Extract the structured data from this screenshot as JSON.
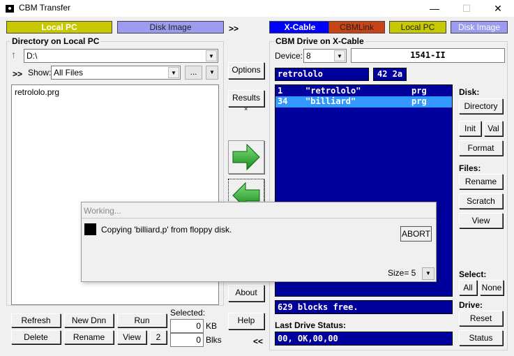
{
  "window": {
    "title": "CBM Transfer",
    "minimize": "—",
    "maximize": "☐",
    "close": "✕"
  },
  "modes_left": {
    "local_pc": "Local PC",
    "disk_image": "Disk Image",
    "forward": ">>"
  },
  "modes_right": {
    "xcable": "X-Cable",
    "cbmlink": "CBMLink",
    "local_pc": "Local PC",
    "disk_image": "Disk Image"
  },
  "local": {
    "group_title": "Directory on Local PC",
    "path": "D:\\",
    "show_label": "Show:",
    "filter": "All Files",
    "expand": ">>",
    "browse": "...",
    "files": [
      "retrololo.prg"
    ]
  },
  "middle": {
    "options": "Options",
    "results": "Results",
    "results_mark": "×",
    "about": "About",
    "help": "Help",
    "back": "<<"
  },
  "bottom_left": {
    "refresh": "Refresh",
    "new_dir": "New Dnn",
    "run": "Run",
    "delete": "Delete",
    "rename": "Rename",
    "view": "View",
    "two": "2",
    "selected_label": "Selected:",
    "kb_value": "0",
    "kb_unit": "KB",
    "blks_value": "0",
    "blks_unit": "Blks"
  },
  "drive": {
    "group_title": "CBM Drive on X-Cable",
    "device_label": "Device:",
    "device": "8",
    "model": "1541-II",
    "disk_name": "retrololo",
    "disk_id": "42 2a",
    "files": [
      {
        "blocks": "1",
        "name": "\"retrololo\"",
        "type": "prg",
        "selected": false
      },
      {
        "blocks": "34",
        "name": "\"billiard\"",
        "type": "prg",
        "selected": true
      }
    ],
    "blocks_free": "629 blocks free.",
    "status_label": "Last Drive Status:",
    "status": "00, OK,00,00"
  },
  "right_panel": {
    "disk_label": "Disk:",
    "directory": "Directory",
    "init": "Init",
    "val": "Val",
    "format": "Format",
    "files_label": "Files:",
    "rename": "Rename",
    "scratch": "Scratch",
    "view": "View",
    "select_label": "Select:",
    "all": "All",
    "none": "None",
    "drive_label": "Drive:",
    "reset": "Reset",
    "status": "Status"
  },
  "dialog": {
    "title": "Working...",
    "message": "Copying 'billiard,p' from floppy disk.",
    "abort": "ABORT",
    "size": "Size= 5"
  },
  "colors": {
    "local_pc_active": "#c8c800",
    "disk_image": "#9b9bf0",
    "xcable_active": "#0000ff",
    "cbmlink": "#c84414",
    "c64_blue": "#00009c",
    "c64_select": "#3399ff"
  }
}
